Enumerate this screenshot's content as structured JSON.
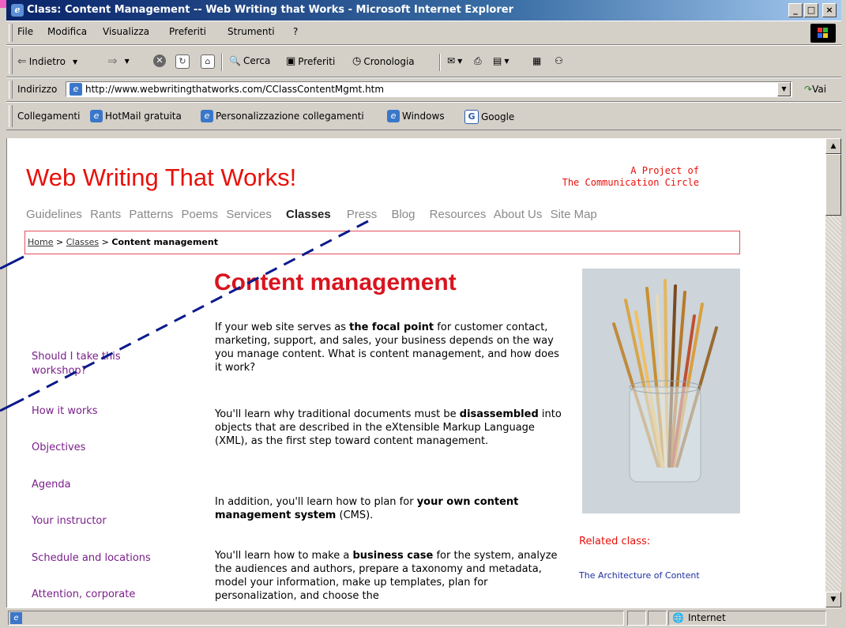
{
  "window": {
    "title": "Class: Content Management -- Web Writing that Works - Microsoft Internet Explorer",
    "minimize": "_",
    "maximize": "□",
    "close": "×"
  },
  "menu": [
    "File",
    "Modifica",
    "Visualizza",
    "Preferiti",
    "Strumenti",
    "?"
  ],
  "toolbar": {
    "back": "Indietro",
    "search": "Cerca",
    "favorites": "Preferiti",
    "history": "Cronologia"
  },
  "address": {
    "label": "Indirizzo",
    "url": "http://www.webwritingthatworks.com/CClassContentMgmt.htm",
    "go": "Vai"
  },
  "links_bar": {
    "label": "Collegamenti",
    "items": [
      "HotMail gratuita",
      "Personalizzazione collegamenti",
      "Windows",
      "Google"
    ]
  },
  "page": {
    "site_title": "Web Writing That Works!",
    "project_line1": "A Project of",
    "project_line2": "The Communication Circle",
    "nav": [
      "Guidelines",
      "Rants",
      "Patterns",
      "Poems",
      "Services",
      "Classes",
      "Press",
      "Blog",
      "Resources",
      "About Us",
      "Site Map"
    ],
    "breadcrumb": {
      "home": "Home",
      "sep": ">",
      "classes": "Classes",
      "current": "Content management"
    },
    "heading": "Content management",
    "paragraphs": [
      {
        "a": "If your web site serves as ",
        "b": "the focal point",
        "c": " for customer contact, marketing, support, and sales, your business depends on the way you manage content. What is content management, and how does it work?"
      },
      {
        "a": "You'll learn why traditional documents must be ",
        "b": "disassembled",
        "c": " into objects that are described in the eXtensible Markup Language (XML), as the first step toward content management."
      },
      {
        "a": "In addition, you'll learn how to plan for ",
        "b": "your own content management system",
        "c": " (CMS)."
      },
      {
        "a": "You'll learn how to make a ",
        "b": "business case",
        "c": " for the system, analyze the audiences and authors, prepare a taxonomy and metadata, model your information, make up templates, plan for personalization, and choose the"
      }
    ],
    "sidebar": [
      "Should I take this workshop?",
      "How it works",
      "Objectives",
      "Agenda",
      "Your instructor",
      "Schedule and locations",
      "Attention, corporate"
    ],
    "related_label": "Related class:",
    "related_link": "The Architecture of Content"
  },
  "status": {
    "zone": "Internet"
  }
}
